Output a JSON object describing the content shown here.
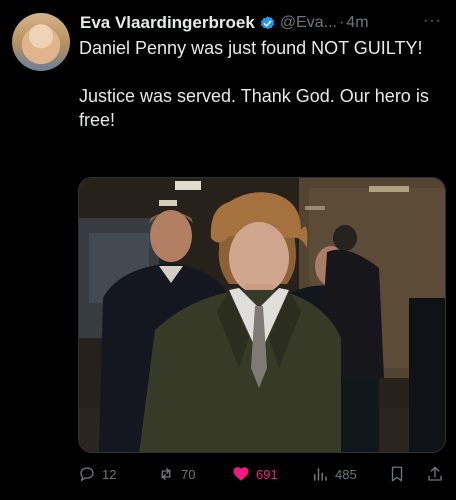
{
  "author": {
    "name": "Eva Vlaardingerbroek",
    "handle": "@Eva...",
    "time": "4m"
  },
  "tweet": {
    "paragraphs": [
      "Daniel Penny was just found NOT GUILTY!",
      "Justice was served. Thank God. Our hero is free!"
    ]
  },
  "actions": {
    "replies": "12",
    "reposts": "70",
    "likes": "691",
    "views": "485"
  },
  "colors": {
    "background": "#000000",
    "text": "#e7e9ea",
    "muted": "#71767b",
    "verified": "#1d9bf0",
    "like": "#f91880"
  },
  "icons": [
    "verified-badge-icon",
    "more-icon",
    "reply-icon",
    "repost-icon",
    "like-icon",
    "views-icon",
    "bookmark-icon",
    "share-icon"
  ]
}
